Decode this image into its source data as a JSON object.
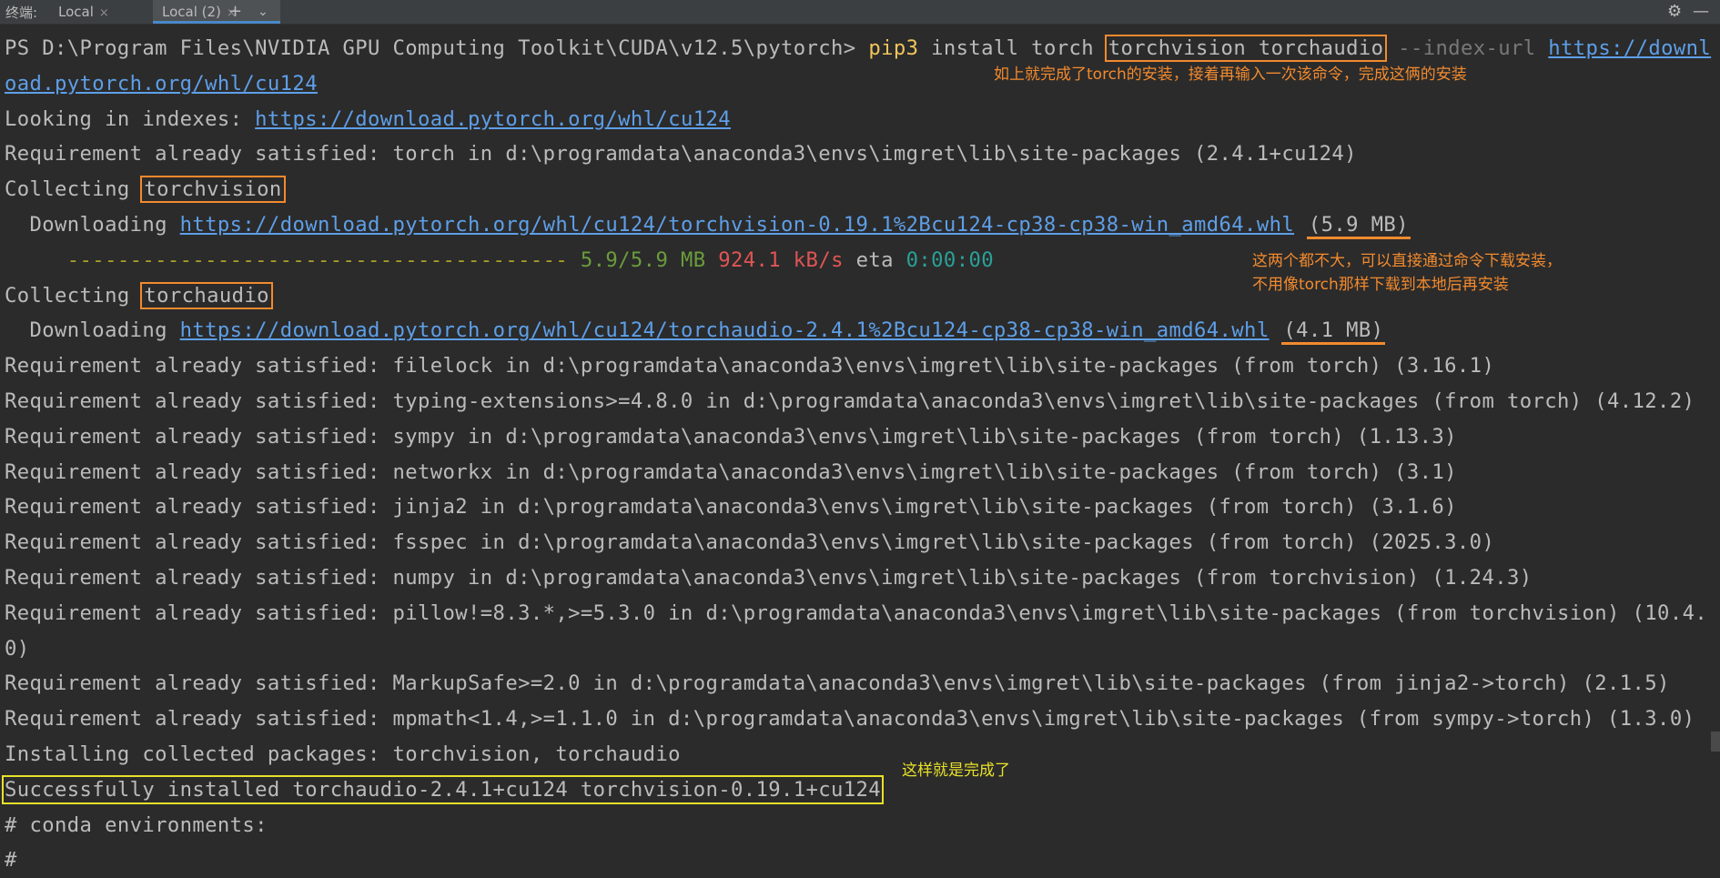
{
  "tabbar": {
    "label": "终端:",
    "tabs": [
      {
        "label": "Local",
        "close": "×"
      },
      {
        "label": "Local (2)",
        "close": "×"
      }
    ],
    "add": "+",
    "dropdown": "⌄",
    "settings": "⚙",
    "minimize": "—"
  },
  "terminal": {
    "prompt": "PS D:\\Program Files\\NVIDIA GPU Computing Toolkit\\CUDA\\v12.5\\pytorch> ",
    "cmd_pip": "pip3",
    "cmd_install": " install torch ",
    "cmd_boxed": "torchvision torchaudio",
    "cmd_flag": " --index-url ",
    "cmd_url_start": "https://downl",
    "cmd_url_cont": "oad.pytorch.org/whl/cu124",
    "looking_label": "Looking in indexes: ",
    "looking_url": "https://download.pytorch.org/whl/cu124",
    "req_torch": "Requirement already satisfied: torch in d:\\programdata\\anaconda3\\envs\\imgret\\lib\\site-packages (2.4.1+cu124)",
    "collecting_label": "Collecting ",
    "collect1": "torchvision",
    "downloading_label": "  Downloading ",
    "dl1_url": "https://download.pytorch.org/whl/cu124/torchvision-0.19.1%2Bcu124-cp38-cp38-win_amd64.whl",
    "dl1_size": "(5.9 MB)",
    "progress_dashes": "     ----------------------------------------",
    "progress_done": "5.9/5.9 MB",
    "progress_speed": "924.1 kB/s",
    "progress_eta_label": "eta",
    "progress_eta": "0:00:00",
    "collect2": "torchaudio",
    "dl2_url": "https://download.pytorch.org/whl/cu124/torchaudio-2.4.1%2Bcu124-cp38-cp38-win_amd64.whl",
    "dl2_size": "(4.1 MB)",
    "req_lines": [
      "Requirement already satisfied: filelock in d:\\programdata\\anaconda3\\envs\\imgret\\lib\\site-packages (from torch) (3.16.1)",
      "Requirement already satisfied: typing-extensions>=4.8.0 in d:\\programdata\\anaconda3\\envs\\imgret\\lib\\site-packages (from torch) (4.12.2)",
      "Requirement already satisfied: sympy in d:\\programdata\\anaconda3\\envs\\imgret\\lib\\site-packages (from torch) (1.13.3)",
      "Requirement already satisfied: networkx in d:\\programdata\\anaconda3\\envs\\imgret\\lib\\site-packages (from torch) (3.1)",
      "Requirement already satisfied: jinja2 in d:\\programdata\\anaconda3\\envs\\imgret\\lib\\site-packages (from torch) (3.1.6)",
      "Requirement already satisfied: fsspec in d:\\programdata\\anaconda3\\envs\\imgret\\lib\\site-packages (from torch) (2025.3.0)",
      "Requirement already satisfied: numpy in d:\\programdata\\anaconda3\\envs\\imgret\\lib\\site-packages (from torchvision) (1.24.3)",
      "Requirement already satisfied: pillow!=8.3.*,>=5.3.0 in d:\\programdata\\anaconda3\\envs\\imgret\\lib\\site-packages (from torchvision) (10.4.",
      "0)",
      "Requirement already satisfied: MarkupSafe>=2.0 in d:\\programdata\\anaconda3\\envs\\imgret\\lib\\site-packages (from jinja2->torch) (2.1.5)",
      "Requirement already satisfied: mpmath<1.4,>=1.1.0 in d:\\programdata\\anaconda3\\envs\\imgret\\lib\\site-packages (from sympy->torch) (1.3.0)",
      "Installing collected packages: torchvision, torchaudio"
    ],
    "success": "Successfully installed torchaudio-2.4.1+cu124 torchvision-0.19.1+cu124",
    "conda_header": "# conda environments:",
    "conda_hash": "#"
  },
  "annotations": {
    "note1": "如上就完成了torch的安装，接着再输入一次该命令，完成这俩的安装",
    "note2_line1": "这两个都不大，可以直接通过命令下载安装，",
    "note2_line2": "不用像torch那样下载到本地后再安装",
    "note3": "这样就是完成了"
  },
  "colors": {
    "background": "#2b2b2b",
    "text": "#bbbbbb",
    "prompt_cmd": "#f2c55c",
    "link": "#5e9fe8",
    "annotation_orange": "#f28a2e",
    "annotation_yellow": "#e8e02a"
  }
}
